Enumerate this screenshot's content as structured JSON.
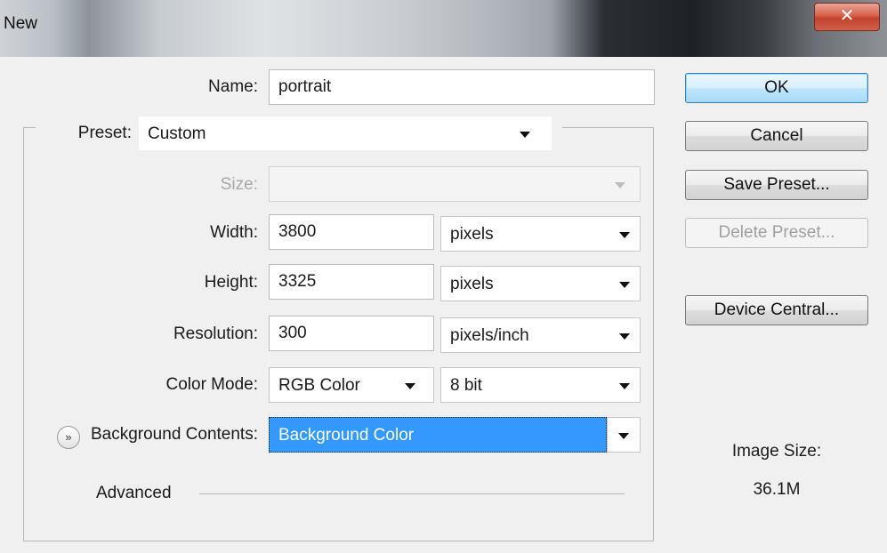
{
  "window": {
    "title": "New",
    "close_glyph": "✕"
  },
  "form": {
    "name": {
      "label": "Name:",
      "value": "portrait"
    },
    "preset": {
      "label": "Preset:",
      "value": "Custom"
    },
    "size": {
      "label": "Size:",
      "value": ""
    },
    "width": {
      "label": "Width:",
      "value": "3800",
      "unit": "pixels"
    },
    "height": {
      "label": "Height:",
      "value": "3325",
      "unit": "pixels"
    },
    "resolution": {
      "label": "Resolution:",
      "value": "300",
      "unit": "pixels/inch"
    },
    "color_mode": {
      "label": "Color Mode:",
      "value": "RGB Color",
      "bit_depth": "8 bit"
    },
    "background": {
      "label": "Background Contents:",
      "value": "Background Color"
    },
    "advanced": {
      "label": "Advanced"
    }
  },
  "buttons": {
    "ok": "OK",
    "cancel": "Cancel",
    "save_preset": "Save Preset...",
    "delete_preset": "Delete Preset...",
    "device_central": "Device Central..."
  },
  "image_size": {
    "label": "Image Size:",
    "value": "36.1M"
  },
  "colors": {
    "highlight": "#3399ff",
    "default_button_border": "#3c7fb1",
    "close_button": "#c94a35"
  }
}
